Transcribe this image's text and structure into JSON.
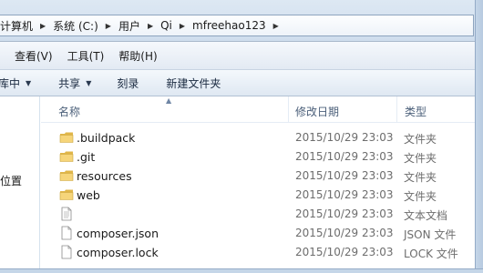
{
  "address_bar": {
    "crumbs": [
      "计算机",
      "系统 (C:)",
      "用户",
      "Qi",
      "mfreehao123"
    ]
  },
  "menu": {
    "items": [
      "查看(V)",
      "工具(T)",
      "帮助(H)"
    ]
  },
  "toolbar": {
    "include_library": "库中",
    "share": "共享",
    "burn": "刻录",
    "new_folder": "新建文件夹"
  },
  "nav": {
    "partial_item": "位置"
  },
  "columns": {
    "name": "名称",
    "date": "修改日期",
    "type": "类型"
  },
  "files": [
    {
      "name": ".buildpack",
      "date": "2015/10/29 23:03",
      "type": "文件夹",
      "icon": "folder-icon"
    },
    {
      "name": ".git",
      "date": "2015/10/29 23:03",
      "type": "文件夹",
      "icon": "folder-icon"
    },
    {
      "name": "resources",
      "date": "2015/10/29 23:03",
      "type": "文件夹",
      "icon": "folder-icon"
    },
    {
      "name": "web",
      "date": "2015/10/29 23:03",
      "type": "文件夹",
      "icon": "folder-icon"
    },
    {
      "name": "",
      "date": "2015/10/29 23:03",
      "type": "文本文档",
      "icon": "text-file-icon"
    },
    {
      "name": "composer.json",
      "date": "2015/10/29 23:03",
      "type": "JSON 文件",
      "icon": "file-icon"
    },
    {
      "name": "composer.lock",
      "date": "2015/10/29 23:03",
      "type": "LOCK 文件",
      "icon": "file-icon"
    }
  ]
}
